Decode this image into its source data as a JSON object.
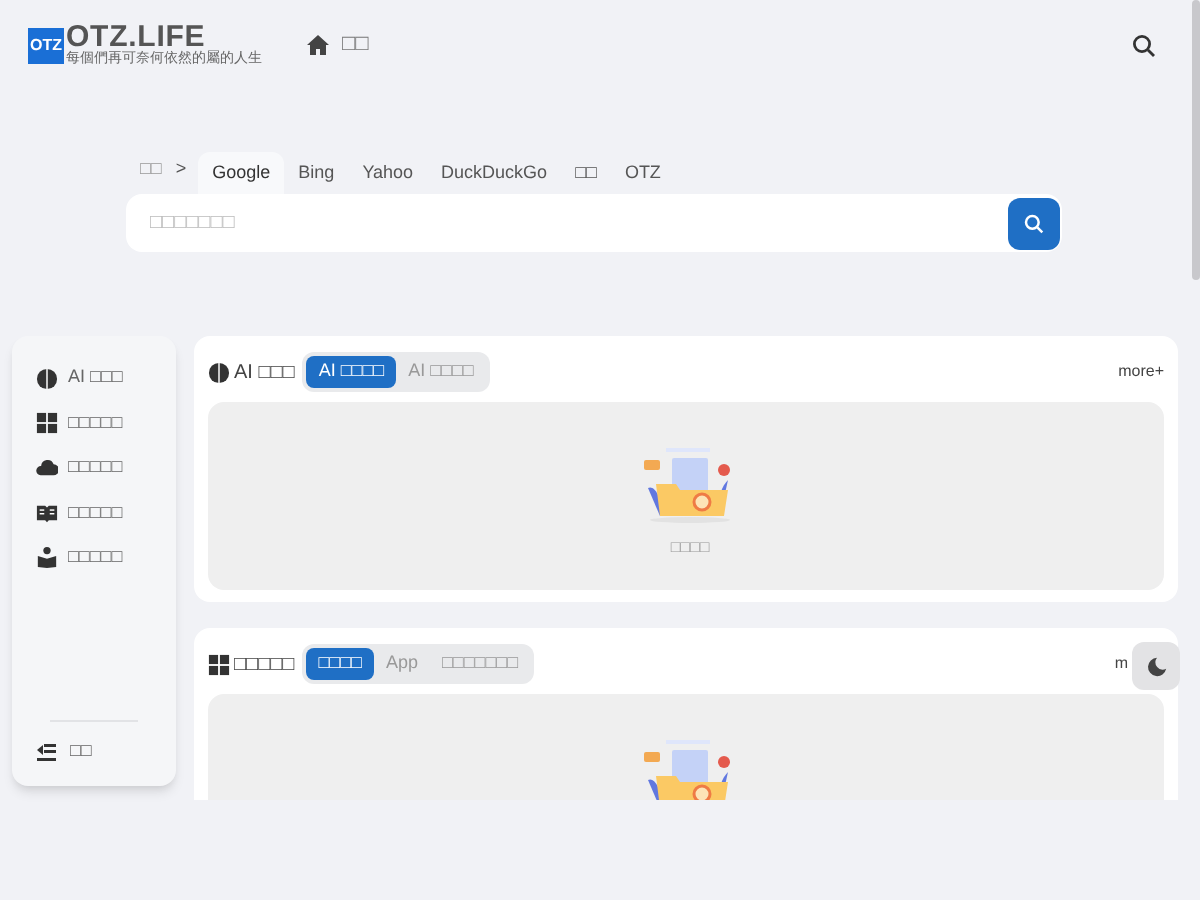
{
  "logo": {
    "badge": "OTZ",
    "name": "OTZ.LIFE",
    "tagline": "每個們再可奈何依然的屬的人生"
  },
  "nav": [
    {
      "label": "□□"
    }
  ],
  "search": {
    "prefix": "□□",
    "separator": ">",
    "placeholder": "□□□□□□□",
    "engines": [
      {
        "label": "Google",
        "selected": true
      },
      {
        "label": "Bing",
        "selected": false
      },
      {
        "label": "Yahoo",
        "selected": false
      },
      {
        "label": "DuckDuckGo",
        "selected": false
      },
      {
        "label": "□□",
        "selected": false
      },
      {
        "label": "OTZ",
        "selected": false
      }
    ]
  },
  "sidebar": {
    "items": [
      {
        "kind": "brain",
        "label": "AI □□□"
      },
      {
        "kind": "grid",
        "label": "□□□□□"
      },
      {
        "kind": "cloud",
        "label": "□□□□□"
      },
      {
        "kind": "book",
        "label": "□□□□□"
      },
      {
        "kind": "reader",
        "label": "□□□□□"
      }
    ],
    "footer": {
      "label": "□□"
    }
  },
  "sections": [
    {
      "kind": "brain",
      "title": "AI □□□",
      "more": "more+",
      "tabs": [
        {
          "label": "AI □□□□",
          "selected": true
        },
        {
          "label": "AI □□□□",
          "selected": false
        }
      ],
      "empty_text": "□□□□"
    },
    {
      "kind": "grid",
      "title": "□□□□□",
      "more": "m",
      "tabs": [
        {
          "label": "□□□□",
          "selected": true
        },
        {
          "label": "App",
          "selected": false
        },
        {
          "label": "□□□□□□□",
          "selected": false
        }
      ]
    }
  ]
}
